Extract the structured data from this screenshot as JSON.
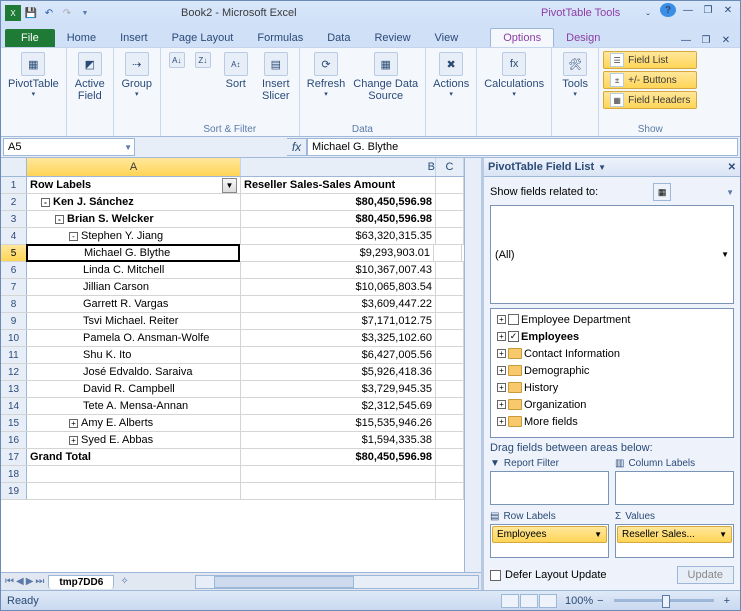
{
  "app": {
    "title": "Book2 - Microsoft Excel",
    "context_tool": "PivotTable Tools"
  },
  "tabs": {
    "file": "File",
    "items": [
      "Home",
      "Insert",
      "Page Layout",
      "Formulas",
      "Data",
      "Review",
      "View"
    ],
    "context": [
      "Options",
      "Design"
    ],
    "active": "Options"
  },
  "ribbon": {
    "pivot": "PivotTable",
    "active_field": "Active\nField",
    "group": "Group",
    "sort": "Sort",
    "insert_slicer": "Insert\nSlicer",
    "refresh": "Refresh",
    "change_source": "Change Data\nSource",
    "actions": "Actions",
    "calculations": "Calculations",
    "tools": "Tools",
    "grp_sortfilter": "Sort & Filter",
    "grp_data": "Data",
    "grp_show": "Show",
    "opt_fieldlist": "Field List",
    "opt_buttons": "+/- Buttons",
    "opt_headers": "Field Headers"
  },
  "namebox": "A5",
  "formula": "Michael G. Blythe",
  "grid": {
    "cols": [
      "A",
      "B",
      "C"
    ],
    "headerA": "Row Labels",
    "headerB": "Reseller Sales-Sales Amount",
    "rows": [
      {
        "rn": 1,
        "type": "head"
      },
      {
        "rn": 2,
        "a": "Ken J. Sánchez",
        "b": "$80,450,596.98",
        "lvl": 1,
        "pm": "-",
        "bold": true
      },
      {
        "rn": 3,
        "a": "Brian S. Welcker",
        "b": "$80,450,596.98",
        "lvl": 2,
        "pm": "-",
        "bold": true
      },
      {
        "rn": 4,
        "a": "Stephen Y. Jiang",
        "b": "$63,320,315.35",
        "lvl": 3,
        "pm": "-"
      },
      {
        "rn": 5,
        "a": "Michael G. Blythe",
        "b": "$9,293,903.01",
        "lvl": 4,
        "active": true
      },
      {
        "rn": 6,
        "a": "Linda C. Mitchell",
        "b": "$10,367,007.43",
        "lvl": 4
      },
      {
        "rn": 7,
        "a": "Jillian Carson",
        "b": "$10,065,803.54",
        "lvl": 4
      },
      {
        "rn": 8,
        "a": "Garrett R. Vargas",
        "b": "$3,609,447.22",
        "lvl": 4
      },
      {
        "rn": 9,
        "a": "Tsvi Michael. Reiter",
        "b": "$7,171,012.75",
        "lvl": 4
      },
      {
        "rn": 10,
        "a": "Pamela O. Ansman-Wolfe",
        "b": "$3,325,102.60",
        "lvl": 4
      },
      {
        "rn": 11,
        "a": "Shu K. Ito",
        "b": "$6,427,005.56",
        "lvl": 4
      },
      {
        "rn": 12,
        "a": "José Edvaldo. Saraiva",
        "b": "$5,926,418.36",
        "lvl": 4
      },
      {
        "rn": 13,
        "a": "David R. Campbell",
        "b": "$3,729,945.35",
        "lvl": 4
      },
      {
        "rn": 14,
        "a": "Tete A. Mensa-Annan",
        "b": "$2,312,545.69",
        "lvl": 4
      },
      {
        "rn": 15,
        "a": "Amy E. Alberts",
        "b": "$15,535,946.26",
        "lvl": 3,
        "pm": "+"
      },
      {
        "rn": 16,
        "a": "Syed E. Abbas",
        "b": "$1,594,335.38",
        "lvl": 3,
        "pm": "+"
      },
      {
        "rn": 17,
        "a": "Grand Total",
        "b": "$80,450,596.98",
        "lvl": 0,
        "bold": true
      },
      {
        "rn": 18,
        "a": "",
        "b": ""
      },
      {
        "rn": 19,
        "a": "",
        "b": ""
      }
    ]
  },
  "sheet_tab": "tmp7DD6",
  "fieldlist": {
    "title": "PivotTable Field List",
    "show_related": "Show fields related to:",
    "related_value": "(All)",
    "items": [
      {
        "label": "Employee Department",
        "checked": false,
        "folder": false
      },
      {
        "label": "Employees",
        "checked": true,
        "folder": false,
        "bold": true
      },
      {
        "label": "Contact Information",
        "folder": true
      },
      {
        "label": "Demographic",
        "folder": true
      },
      {
        "label": "History",
        "folder": true
      },
      {
        "label": "Organization",
        "folder": true
      },
      {
        "label": "More fields",
        "folder": true
      }
    ],
    "drag_label": "Drag fields between areas below:",
    "areas": {
      "report_filter": "Report Filter",
      "column_labels": "Column Labels",
      "row_labels": "Row Labels",
      "values": "Values"
    },
    "chip_rows": "Employees",
    "chip_vals": "Reseller Sales...",
    "defer": "Defer Layout Update",
    "update": "Update"
  },
  "status": {
    "ready": "Ready",
    "zoom": "100%"
  }
}
